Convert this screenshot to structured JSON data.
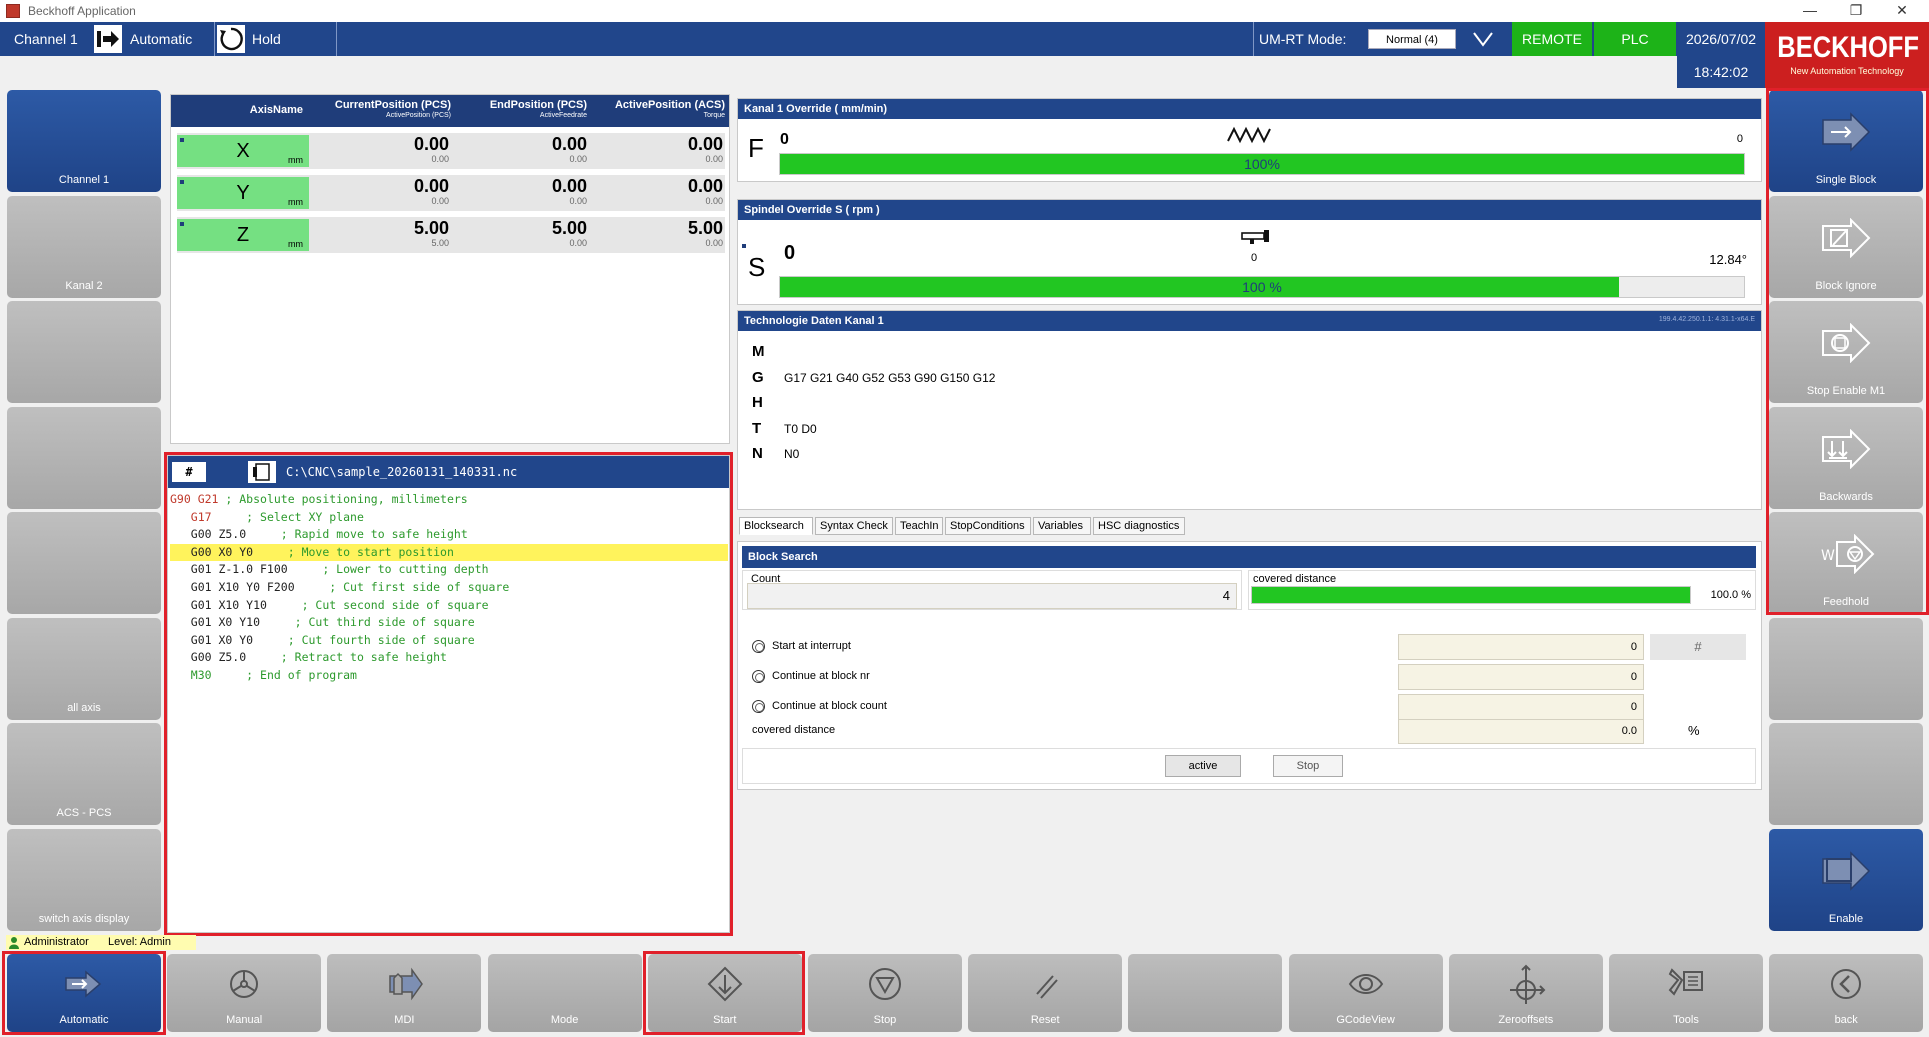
{
  "window": {
    "title": "Beckhoff Application",
    "controls": [
      "—",
      "❐",
      "✕"
    ]
  },
  "topbar": {
    "channel_label": "Channel  1",
    "mode_label": "Automatic",
    "hold_label": "Hold",
    "umrt_label": "UM-RT Mode:",
    "umrt_value": "Normal (4)",
    "remote": "REMOTE",
    "plc": "PLC",
    "date": "2026/07/02",
    "time": "18:42:02"
  },
  "logo": {
    "name": "BECKHOFF",
    "tagline": "New Automation Technology"
  },
  "left_buttons": [
    {
      "label": "Channel 1",
      "active": true
    },
    {
      "label": "Kanal 2",
      "active": false
    },
    {
      "label": "",
      "active": false
    },
    {
      "label": "",
      "active": false
    },
    {
      "label": "",
      "active": false
    },
    {
      "label": "all axis",
      "active": false
    },
    {
      "label": "ACS - PCS",
      "active": false
    },
    {
      "label": "switch axis display",
      "active": false
    }
  ],
  "right_buttons": [
    {
      "label": "Single Block",
      "icon": "single-block-icon",
      "active": true
    },
    {
      "label": "Block Ignore",
      "icon": "block-ignore-icon",
      "active": false
    },
    {
      "label": "Stop Enable M1",
      "icon": "stop-enable-icon",
      "active": false
    },
    {
      "label": "Backwards",
      "icon": "backwards-icon",
      "active": false
    },
    {
      "label": "Feedhold",
      "icon": "feedhold-icon",
      "active": false
    },
    {
      "label": "",
      "icon": "",
      "active": false
    },
    {
      "label": "",
      "icon": "",
      "active": false
    },
    {
      "label": "Enable",
      "icon": "enable-icon",
      "active": true
    }
  ],
  "axis_table": {
    "headers": {
      "name": "AxisName",
      "current": "CurrentPosition (PCS)",
      "current_sub": "ActivePosition (PCS)",
      "end": "EndPosition (PCS)",
      "end_sub": "ActiveFeedrate",
      "active": "ActivePosition (ACS)",
      "active_sub": "Torque"
    },
    "rows": [
      {
        "name": "X",
        "unit": "mm",
        "current": "0.00",
        "current_sub": "0.00",
        "end": "0.00",
        "end_sub": "0.00",
        "active": "0.00",
        "active_sub": "0.00"
      },
      {
        "name": "Y",
        "unit": "mm",
        "current": "0.00",
        "current_sub": "0.00",
        "end": "0.00",
        "end_sub": "0.00",
        "active": "0.00",
        "active_sub": "0.00"
      },
      {
        "name": "Z",
        "unit": "mm",
        "current": "5.00",
        "current_sub": "5.00",
        "end": "5.00",
        "end_sub": "0.00",
        "active": "5.00",
        "active_sub": "0.00"
      }
    ]
  },
  "program": {
    "hash_label": "#",
    "path": "C:\\CNC\\sample_20260131_140331.nc",
    "lines": [
      {
        "code": "G90 G21",
        "comment": "; Absolute positioning, millimeters",
        "style": "red",
        "highlight": false
      },
      {
        "code": "   G17",
        "comment": "    ; Select XY plane",
        "style": "red",
        "highlight": false
      },
      {
        "code": "   G00 Z5.0",
        "comment": "    ; Rapid move to safe height",
        "style": "mix",
        "highlight": false
      },
      {
        "code": "   G00 X0 Y0",
        "comment": "    ; Move to start position",
        "style": "mix",
        "highlight": true
      },
      {
        "code": "   G01 Z-1.0 F100",
        "comment": "    ; Lower to cutting depth",
        "style": "mix",
        "highlight": false
      },
      {
        "code": "   G01 X10 Y0 F200",
        "comment": "    ; Cut first side of square",
        "style": "mix",
        "highlight": false
      },
      {
        "code": "   G01 X10 Y10",
        "comment": "    ; Cut second side of square",
        "style": "mix",
        "highlight": false
      },
      {
        "code": "   G01 X0 Y10",
        "comment": "    ; Cut third side of square",
        "style": "mix",
        "highlight": false
      },
      {
        "code": "   G01 X0 Y0",
        "comment": "    ; Cut fourth side of square",
        "style": "mix",
        "highlight": false
      },
      {
        "code": "   G00 Z5.0",
        "comment": "    ; Retract to safe height",
        "style": "mix",
        "highlight": false
      },
      {
        "code": "   M30",
        "comment": "    ; End of program",
        "style": "green",
        "highlight": false
      }
    ]
  },
  "feed_override": {
    "title": "Kanal 1 Override  ( mm/min)",
    "letter": "F",
    "value": "0",
    "right_value": "0",
    "percent": 100,
    "percent_text": "100%"
  },
  "spindle_override": {
    "title": "Spindel Override S ( rpm    )",
    "letter": "S",
    "value": "0",
    "center_value": "0",
    "right_value": "12.84°",
    "percent": 87,
    "percent_text": "100 %"
  },
  "tech": {
    "title": "Technologie Daten Kanal 1",
    "version": "199.4.42.250.1.1: 4.31.1-x64.E",
    "rows": [
      {
        "key": "M",
        "value": ""
      },
      {
        "key": "G",
        "value": "G17 G21 G40 G52 G53 G90 G150 G12"
      },
      {
        "key": "H",
        "value": ""
      },
      {
        "key": "T",
        "value": "T0   D0"
      },
      {
        "key": "N",
        "value": "N0"
      }
    ]
  },
  "tabs": [
    {
      "label": "Blocksearch",
      "active": true
    },
    {
      "label": "Syntax Check",
      "active": false
    },
    {
      "label": "TeachIn",
      "active": false
    },
    {
      "label": "StopConditions",
      "active": false
    },
    {
      "label": "Variables",
      "active": false
    },
    {
      "label": "HSC diagnostics",
      "active": false
    }
  ],
  "block_search": {
    "title": "Block Search",
    "count_label": "Count",
    "count_value": "4",
    "distance_label": "covered distance",
    "distance_percent": 100,
    "distance_text": "100.0 %",
    "options": [
      {
        "label": "Start at interrupt",
        "value": "0",
        "suffix": "#"
      },
      {
        "label": "Continue at block nr",
        "value": "0",
        "suffix": ""
      },
      {
        "label": "Continue at block count",
        "value": "0",
        "suffix": ""
      }
    ],
    "covered_label": "covered distance",
    "covered_value": "0.0",
    "covered_unit": "%",
    "active_btn": "active",
    "stop_btn": "Stop"
  },
  "user": {
    "name": "Administrator",
    "level": "Level: Admin"
  },
  "bottom_buttons": [
    {
      "label": "Automatic",
      "icon": "automatic-icon",
      "active": true
    },
    {
      "label": "Manual",
      "icon": "manual-icon",
      "active": false
    },
    {
      "label": "MDI",
      "icon": "mdi-icon",
      "active": false
    },
    {
      "label": "Mode",
      "icon": "",
      "active": false
    },
    {
      "label": "Start",
      "icon": "start-icon",
      "active": false
    },
    {
      "label": "Stop",
      "icon": "stop-icon",
      "active": false
    },
    {
      "label": "Reset",
      "icon": "reset-icon",
      "active": false
    },
    {
      "label": "",
      "icon": "",
      "active": false
    },
    {
      "label": "GCodeView",
      "icon": "eye-icon",
      "active": false
    },
    {
      "label": "Zerooffsets",
      "icon": "zerooffset-icon",
      "active": false
    },
    {
      "label": "Tools",
      "icon": "tools-icon",
      "active": false
    },
    {
      "label": "back",
      "icon": "back-icon",
      "active": false
    }
  ]
}
